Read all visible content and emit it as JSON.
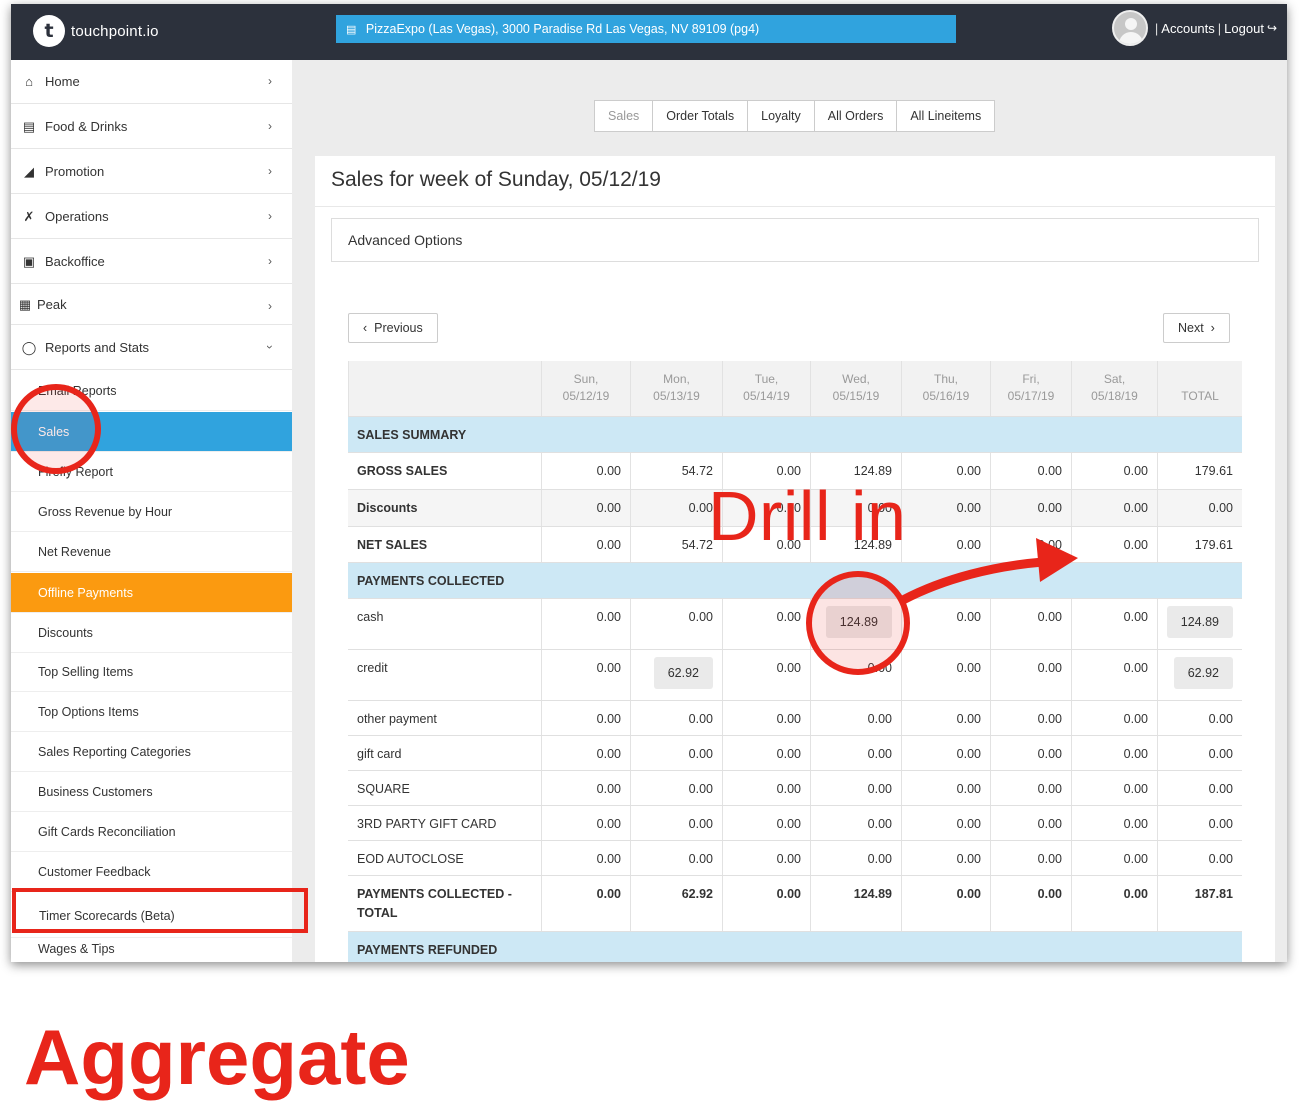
{
  "app": {
    "logo_text": "touchpoint.io",
    "location": "PizzaExpo (Las Vegas), 3000 Paradise Rd Las Vegas, NV 89109 (pg4)",
    "accounts_label": "Accounts",
    "logout_label": "Logout"
  },
  "sidebar": {
    "nav": [
      {
        "label": "Home",
        "icon": "home-icon"
      },
      {
        "label": "Food & Drinks",
        "icon": "menu-book-icon"
      },
      {
        "label": "Promotion",
        "icon": "megaphone-icon"
      },
      {
        "label": "Operations",
        "icon": "tools-icon"
      },
      {
        "label": "Backoffice",
        "icon": "briefcase-icon"
      },
      {
        "label": "Peak",
        "icon": "image-icon"
      },
      {
        "label": "Reports and Stats",
        "icon": "gauge-icon"
      }
    ],
    "sub_items": [
      "Email Reports",
      "Sales",
      "Firefly Report",
      "Gross Revenue by Hour",
      "Net Revenue",
      "Offline Payments",
      "Discounts",
      "Top Selling Items",
      "Top Options Items",
      "Sales Reporting Categories",
      "Business Customers",
      "Gift Cards Reconciliation",
      "Customer Feedback",
      "Timer Scorecards (Beta)",
      "Wages & Tips"
    ]
  },
  "tabs": [
    "Sales",
    "Order Totals",
    "Loyalty",
    "All Orders",
    "All Lineitems"
  ],
  "page_title": "Sales for week of Sunday, 05/12/19",
  "advanced_options_label": "Advanced Options",
  "previous_label": "Previous",
  "next_label": "Next",
  "table": {
    "columns": [
      {
        "day": "Sun,",
        "date": "05/12/19"
      },
      {
        "day": "Mon,",
        "date": "05/13/19"
      },
      {
        "day": "Tue,",
        "date": "05/14/19"
      },
      {
        "day": "Wed,",
        "date": "05/15/19"
      },
      {
        "day": "Thu,",
        "date": "05/16/19"
      },
      {
        "day": "Fri,",
        "date": "05/17/19"
      },
      {
        "day": "Sat,",
        "date": "05/18/19"
      }
    ],
    "total_header": "TOTAL",
    "sections": {
      "sales_summary": "SALES SUMMARY",
      "payments_collected": "PAYMENTS COLLECTED",
      "payments_refunded": "PAYMENTS REFUNDED"
    },
    "rows": [
      {
        "label": "GROSS SALES",
        "values": [
          "0.00",
          "54.72",
          "0.00",
          "124.89",
          "0.00",
          "0.00",
          "0.00",
          "179.61"
        ]
      },
      {
        "label": "Discounts",
        "values": [
          "0.00",
          "0.00",
          "0.00",
          "0.00",
          "0.00",
          "0.00",
          "0.00",
          "0.00"
        ]
      },
      {
        "label": "NET SALES",
        "values": [
          "0.00",
          "54.72",
          "0.00",
          "124.89",
          "0.00",
          "0.00",
          "0.00",
          "179.61"
        ]
      },
      {
        "label": "cash",
        "values": [
          "0.00",
          "0.00",
          "0.00",
          "124.89",
          "0.00",
          "0.00",
          "0.00",
          "124.89"
        ]
      },
      {
        "label": "credit",
        "values": [
          "0.00",
          "62.92",
          "0.00",
          "0.00",
          "0.00",
          "0.00",
          "0.00",
          "62.92"
        ]
      },
      {
        "label": "other payment",
        "values": [
          "0.00",
          "0.00",
          "0.00",
          "0.00",
          "0.00",
          "0.00",
          "0.00",
          "0.00"
        ]
      },
      {
        "label": "gift card",
        "values": [
          "0.00",
          "0.00",
          "0.00",
          "0.00",
          "0.00",
          "0.00",
          "0.00",
          "0.00"
        ]
      },
      {
        "label": "SQUARE",
        "values": [
          "0.00",
          "0.00",
          "0.00",
          "0.00",
          "0.00",
          "0.00",
          "0.00",
          "0.00"
        ]
      },
      {
        "label": "3RD PARTY GIFT CARD",
        "values": [
          "0.00",
          "0.00",
          "0.00",
          "0.00",
          "0.00",
          "0.00",
          "0.00",
          "0.00"
        ]
      },
      {
        "label": "EOD AUTOCLOSE",
        "values": [
          "0.00",
          "0.00",
          "0.00",
          "0.00",
          "0.00",
          "0.00",
          "0.00",
          "0.00"
        ]
      },
      {
        "label": "PAYMENTS COLLECTED - TOTAL",
        "values": [
          "0.00",
          "62.92",
          "0.00",
          "124.89",
          "0.00",
          "0.00",
          "0.00",
          "187.81"
        ]
      }
    ]
  },
  "annotations": {
    "drill_in": "Drill in",
    "aggregate": "Aggregate",
    "color": "#e8251a"
  },
  "colors": {
    "topbar": "#2c313c",
    "accent_blue": "#30a3de",
    "offline_orange": "#fb9a10",
    "section_bg": "#cde8f5"
  }
}
